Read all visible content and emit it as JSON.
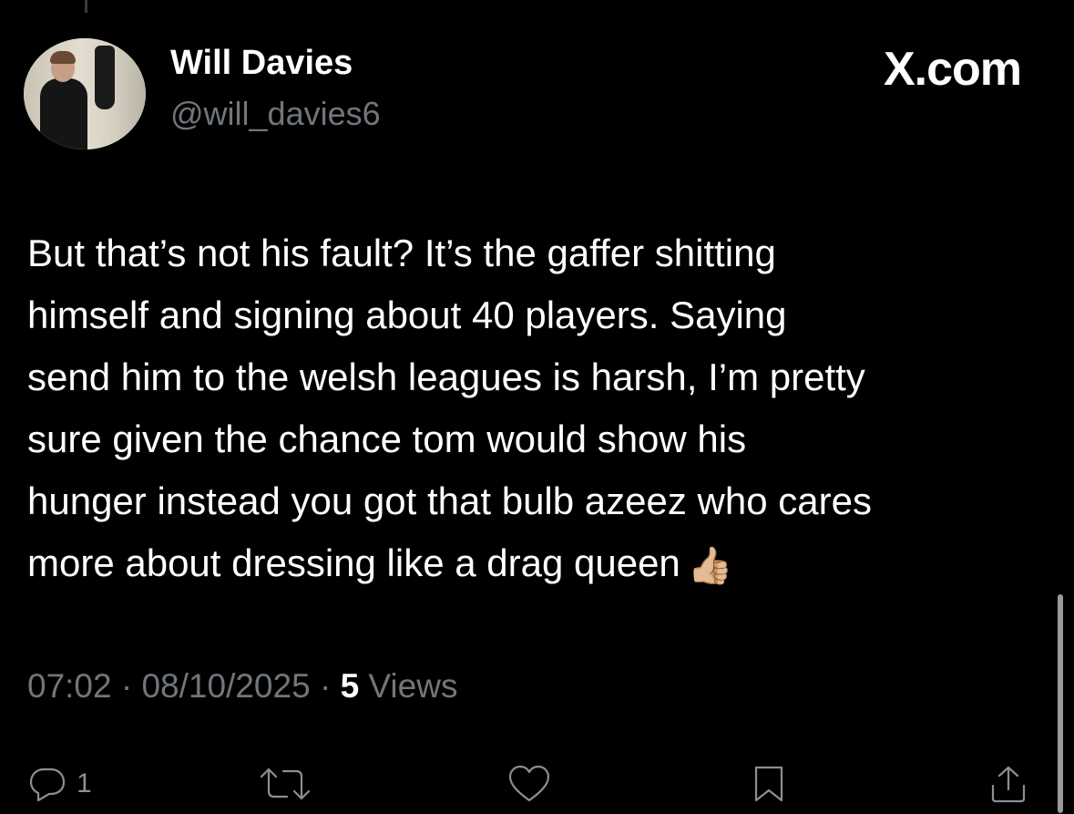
{
  "author": {
    "display_name": "Will Davies",
    "handle": "@will_davies6"
  },
  "brand": {
    "label": "X.com"
  },
  "tweet": {
    "lines": [
      "But that’s not his fault? It’s the gaffer shitting",
      "himself and signing about 40 players. Saying",
      "send him to the welsh leagues is harsh, I’m pretty",
      "sure given the chance tom would show his",
      "hunger instead you got that bulb azeez who cares",
      "more about dressing like a drag queen"
    ],
    "emoji": "👍🏼"
  },
  "meta": {
    "time": "07:02",
    "separator": "·",
    "date": "08/10/2025",
    "views_count": "5",
    "views_label": "Views"
  },
  "actions": {
    "reply_icon": "reply-icon",
    "reply_count": "1",
    "retweet_icon": "retweet-icon",
    "like_icon": "heart-icon",
    "bookmark_icon": "bookmark-icon",
    "share_icon": "share-icon"
  },
  "colors": {
    "background": "#000000",
    "text_primary": "#ffffff",
    "text_secondary": "#71767b",
    "icon": "#8b8f94"
  }
}
